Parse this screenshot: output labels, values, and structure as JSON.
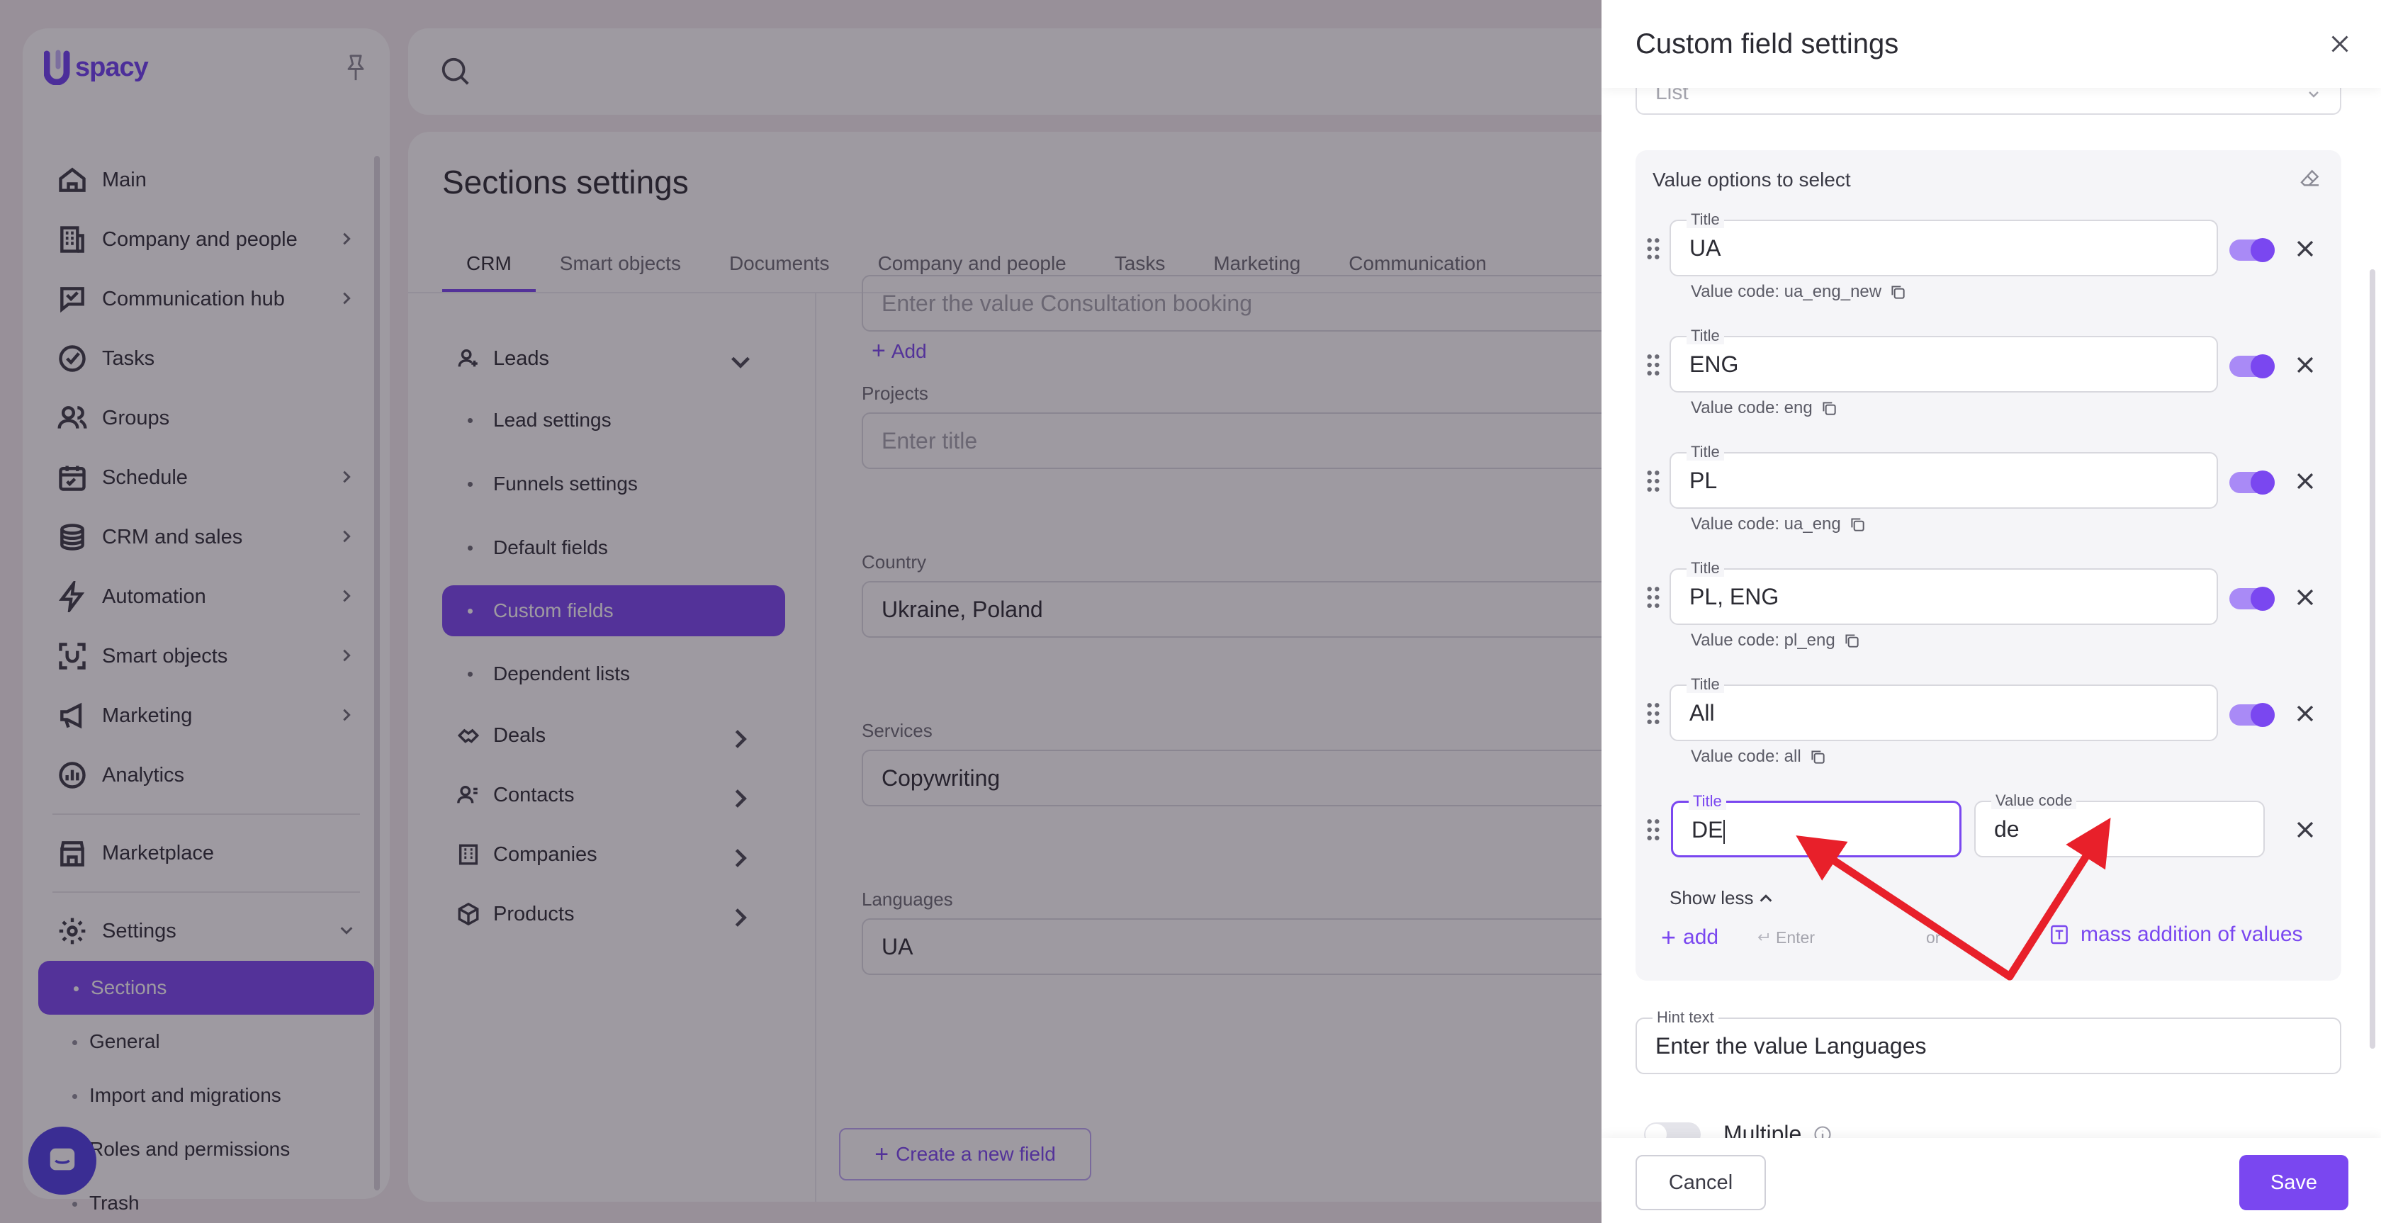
{
  "app": {
    "logo_text": "spacy"
  },
  "sidebar": {
    "items": [
      {
        "label": "Main",
        "icon": "home-icon"
      },
      {
        "label": "Company and people",
        "icon": "building-icon",
        "chevron": true
      },
      {
        "label": "Communication hub",
        "icon": "chat-icon",
        "chevron": true
      },
      {
        "label": "Tasks",
        "icon": "check-circle-icon"
      },
      {
        "label": "Groups",
        "icon": "users-icon"
      },
      {
        "label": "Schedule",
        "icon": "calendar-icon",
        "chevron": true
      },
      {
        "label": "CRM and sales",
        "icon": "coins-icon",
        "chevron": true
      },
      {
        "label": "Automation",
        "icon": "lightning-icon",
        "chevron": true
      },
      {
        "label": "Smart objects",
        "icon": "scan-icon",
        "chevron": true
      },
      {
        "label": "Marketing",
        "icon": "megaphone-icon",
        "chevron": true
      },
      {
        "label": "Analytics",
        "icon": "chart-icon"
      }
    ],
    "marketplace": "Marketplace",
    "settings": "Settings",
    "settings_sub": [
      "Sections",
      "General",
      "Import and migrations",
      "Roles and permissions",
      "Trash"
    ]
  },
  "main": {
    "title": "Sections settings",
    "tabs": [
      "CRM",
      "Smart objects",
      "Documents",
      "Company and people",
      "Tasks",
      "Marketing",
      "Communication"
    ],
    "menu": {
      "leads": "Leads",
      "leads_sub": [
        "Lead settings",
        "Funnels settings",
        "Default fields",
        "Custom fields",
        "Dependent lists"
      ],
      "groups": [
        "Deals",
        "Contacts",
        "Companies",
        "Products"
      ]
    },
    "form": {
      "top_placeholder": "Enter the value Consultation booking",
      "add_label": "Add",
      "projects_label": "Projects",
      "projects_placeholder": "Enter title",
      "country_label": "Country",
      "country_value": "Ukraine, Poland",
      "services_label": "Services",
      "services_value": "Copywriting",
      "languages_label": "Languages",
      "languages_value": "UA",
      "create_field": "Create a new field"
    }
  },
  "drawer": {
    "title": "Custom field settings",
    "type_value": "List",
    "options_heading": "Value options to select",
    "options": [
      {
        "title_label": "Title",
        "title": "UA",
        "code_text": "Value code: ua_eng_new"
      },
      {
        "title_label": "Title",
        "title": "ENG",
        "code_text": "Value code: eng"
      },
      {
        "title_label": "Title",
        "title": "PL",
        "code_text": "Value code: ua_eng"
      },
      {
        "title_label": "Title",
        "title": "PL, ENG",
        "code_text": "Value code: pl_eng"
      },
      {
        "title_label": "Title",
        "title": "All",
        "code_text": "Value code: all"
      }
    ],
    "new_option": {
      "title_label": "Title",
      "title": "DE",
      "code_label": "Value code",
      "code": "de"
    },
    "show_less": "Show less",
    "add": "add",
    "enter_hint": "Enter",
    "or": "or",
    "mass_add": "mass addition of values",
    "hint_label": "Hint text",
    "hint_value": "Enter the value Languages",
    "multiple": "Multiple",
    "cancel": "Cancel",
    "save": "Save"
  },
  "colors": {
    "accent": "#7a47f0",
    "annotation_arrow": "#e8202a"
  }
}
